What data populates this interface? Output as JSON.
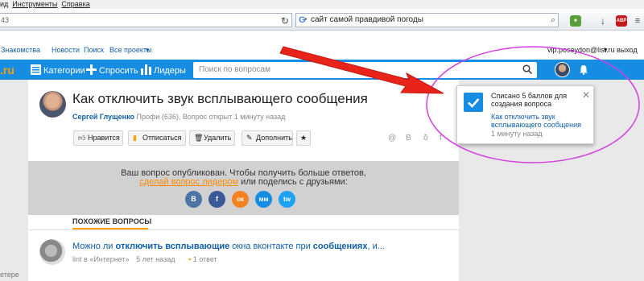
{
  "browser": {
    "menu": [
      "ид",
      "Инструменты",
      "Справка"
    ],
    "address_text": "43",
    "search_text": "сайт самой правдивой погоды"
  },
  "toplinks": {
    "left": [
      "Знакомства",
      "Новости",
      "Поиск",
      "Все проекты"
    ],
    "user": "vip.poseydon@list.ru",
    "logout": "выход"
  },
  "header": {
    "logo": ".ru",
    "nav": [
      "Категории",
      "Спросить",
      "Лидеры"
    ],
    "search_placeholder": "Поиск по вопросам"
  },
  "question": {
    "title": "Как отключить звук всплывающего сообщения",
    "author": "Сергей Глущенко",
    "meta": "Профи (636), Вопрос открыт 1 минуту назад",
    "buttons": [
      "Нравится",
      "Отписаться",
      "Удалить",
      "Дополнить"
    ]
  },
  "banner": {
    "line1": "Ваш вопрос опубликован. Чтобы получить больше ответов,",
    "link": "сделай вопрос лидером",
    "line2_rest": "или поделись с друзьями:",
    "social": [
      "В",
      "f",
      "ок",
      "мм",
      "tw"
    ]
  },
  "similar": {
    "heading": "ПОХОЖИЕ ВОПРОСЫ",
    "item": {
      "t1": "Можно ли ",
      "t2": "отключить всплывающие",
      "t3": " окна вконтакте при ",
      "t4": "сообщениях",
      "t5": ", и...",
      "author": "lint",
      "category": "в «Интернет»",
      "time": "5 лет назад",
      "answers": "1 ответ"
    }
  },
  "left_clip": "етере",
  "popup": {
    "text": "Списано 5 баллов для создания вопроса",
    "link": "Как отключить звук всплывающего сообщения",
    "time": "1 минуту назад"
  },
  "colors": {
    "brand_blue": "#168de2",
    "accent_orange": "#ff9e00",
    "annotation_red": "#e8231a",
    "annotation_magenta": "#d43fe0"
  }
}
